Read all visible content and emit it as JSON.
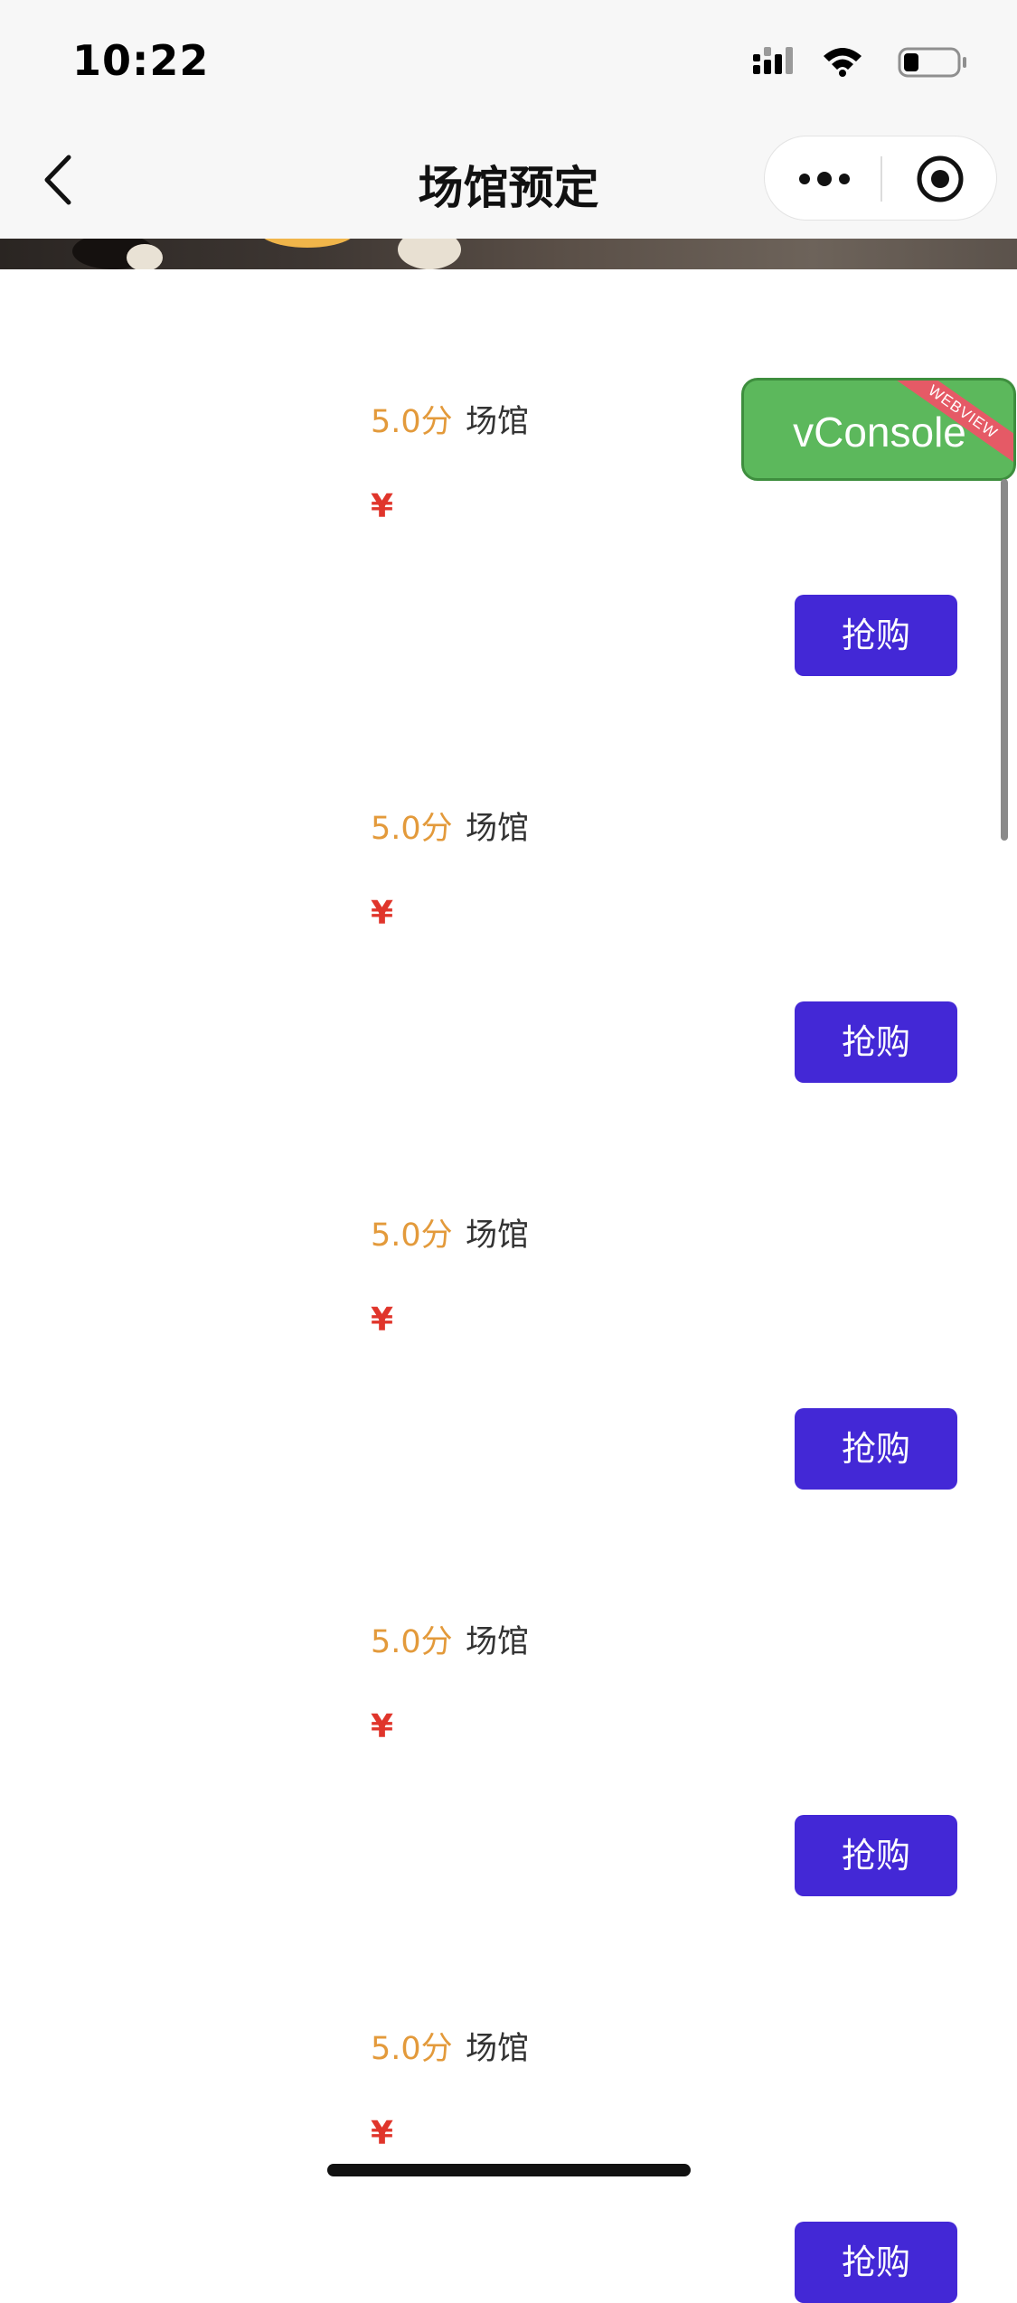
{
  "status_bar": {
    "time": "10:22",
    "icons": [
      "cellular-signal-icon",
      "wifi-icon",
      "battery-icon"
    ]
  },
  "nav": {
    "title": "场馆预定",
    "back_icon": "chevron-left-icon",
    "more_icon": "more-dots-icon",
    "close_icon": "target-circle-icon"
  },
  "venues": [
    {
      "rating": "5.0分",
      "name": "场馆",
      "price": "¥",
      "button": "抢购"
    },
    {
      "rating": "5.0分",
      "name": "场馆",
      "price": "¥",
      "button": "抢购"
    },
    {
      "rating": "5.0分",
      "name": "场馆",
      "price": "¥",
      "button": "抢购"
    },
    {
      "rating": "5.0分",
      "name": "场馆",
      "price": "¥",
      "button": "抢购"
    },
    {
      "rating": "5.0分",
      "name": "场馆",
      "price": "¥",
      "button": "抢购"
    }
  ],
  "vconsole": {
    "label": "vConsole",
    "ribbon": "WEBVIEW"
  },
  "colors": {
    "rating": "#e39a3b",
    "price": "#e0352b",
    "button": "#4328d6",
    "vconsole": "#5cb85c"
  }
}
